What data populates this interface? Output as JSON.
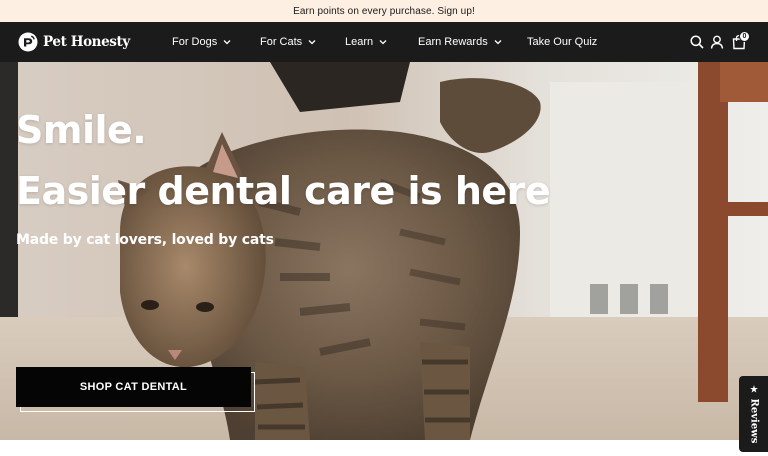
{
  "promo": {
    "text": "Earn points on every purchase. Sign up!"
  },
  "brand": {
    "name": "Pet Honesty"
  },
  "nav": {
    "items": [
      {
        "label": "For Dogs",
        "has_dropdown": true
      },
      {
        "label": "For Cats",
        "has_dropdown": true
      },
      {
        "label": "Learn",
        "has_dropdown": true
      },
      {
        "label": "Earn Rewards",
        "has_dropdown": true
      },
      {
        "label": "Take Our Quiz",
        "has_dropdown": false
      }
    ],
    "icons": [
      "search-icon",
      "account-icon",
      "cart-icon"
    ],
    "cart_count": "0"
  },
  "hero": {
    "title_line1": "Smile.",
    "title_line2": "Easier dental care is here",
    "subtitle": "Made by cat lovers, loved by cats",
    "cta_label": "SHOP CAT DENTAL"
  },
  "reviews_tab": {
    "label": "Reviews",
    "icon": "star-icon"
  },
  "colors": {
    "promo_bg": "#fdf0e2",
    "nav_bg": "#1b1b1b",
    "cta_bg": "#050505",
    "hero_text": "#ffffff"
  }
}
